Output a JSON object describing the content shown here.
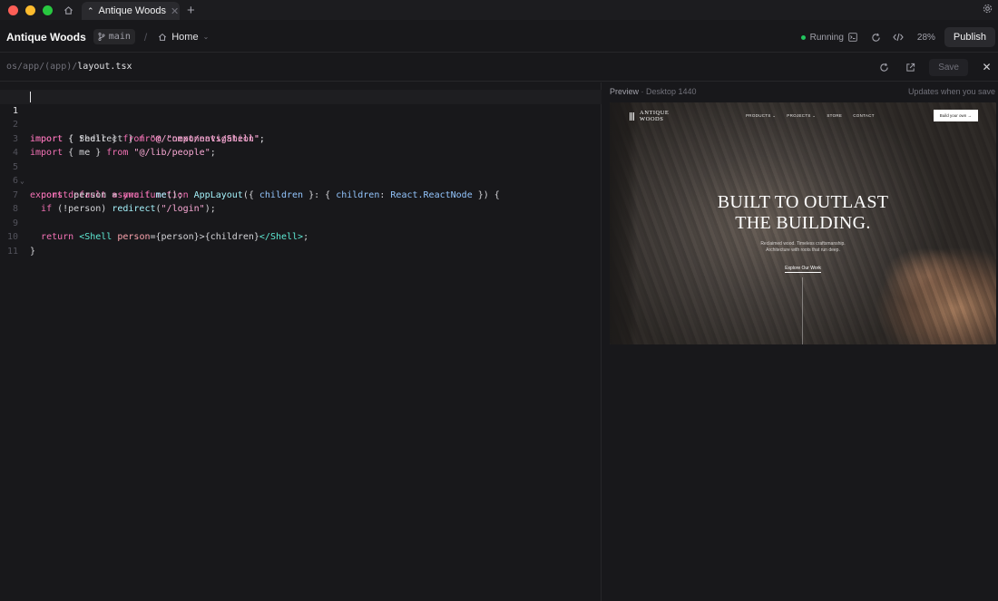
{
  "titlebar": {
    "tab_label": "Antique Woods"
  },
  "toolbar": {
    "project_name": "Antique Woods",
    "branch": "main",
    "breadcrumb_sep": "/",
    "page": "Home",
    "status": "Running",
    "zoom": "28%",
    "publish_label": "Publish"
  },
  "file": {
    "path_prefix": "os/app/(app)/",
    "file_name": "layout.tsx",
    "save_label": "Save"
  },
  "editor": {
    "line_numbers": [
      "1",
      "2",
      "3",
      "4",
      "5",
      "6",
      "7",
      "8",
      "9",
      "10",
      "11"
    ],
    "line1": {
      "kw1": "import",
      "p1": " { redirect } ",
      "kw2": "from",
      "p2": " ",
      "str": "\"next/navigation\"",
      "p3": ";"
    },
    "line2": {
      "kw1": "import",
      "p1": " { Shell } ",
      "kw2": "from",
      "p2": " ",
      "str": "\"@/components/Shell\"",
      "p3": ";"
    },
    "line3": {
      "kw1": "import",
      "p1": " { me } ",
      "kw2": "from",
      "p2": " ",
      "str": "\"@/lib/people\"",
      "p3": ";"
    },
    "line5": {
      "kw": "export default async function",
      "sp": " ",
      "fn": "AppLayout",
      "p1": "({ ",
      "prop1": "children",
      "p2": " }: { ",
      "prop2": "children",
      "p3": ": ",
      "type": "React.ReactNode",
      "p4": " }) {"
    },
    "line6": {
      "indent": "  ",
      "kw": "const",
      "p1": " person = ",
      "kw2": "await",
      "p2": " ",
      "fn": "me",
      "p3": "();"
    },
    "line7": {
      "indent": "  ",
      "kw": "if",
      "p1": " (!person) ",
      "fn": "redirect",
      "p2": "(",
      "str": "\"/login\"",
      "p3": ");"
    },
    "line9": {
      "indent": "  ",
      "kw": "return",
      "p1": " ",
      "tag1": "<Shell",
      "sp": " ",
      "attr": "person",
      "p2": "={person}>{children}",
      "tag2": "</Shell>",
      "p3": ";"
    },
    "line10": {
      "text": "}"
    }
  },
  "preview": {
    "label": "Preview",
    "device": " · Desktop 1440",
    "note": "Updates when you save",
    "site": {
      "logo_line1": "ANTIQUE",
      "logo_line2": "WOODS",
      "nav": [
        "PRODUCTS ⌄",
        "PROJECTS ⌄",
        "STORE",
        "CONTACT"
      ],
      "cta_button": "Build your own →",
      "hero_line1": "BUILT TO OUTLAST",
      "hero_line2": "THE BUILDING.",
      "hero_sub1": "Reclaimed wood. Timeless craftsmanship.",
      "hero_sub2": "Architecture with roots that run deep.",
      "hero_link": "Explore Our Work"
    }
  }
}
